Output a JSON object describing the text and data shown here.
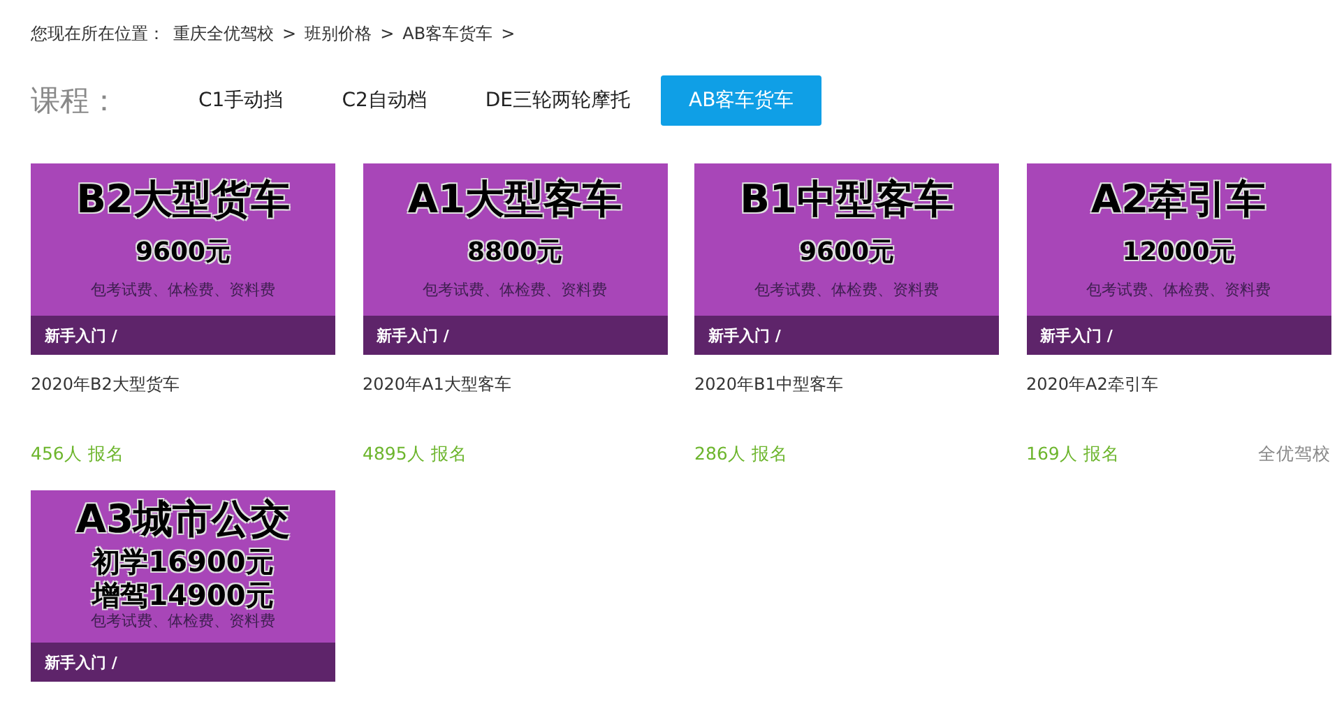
{
  "breadcrumb": {
    "prefix": "您现在所在位置：",
    "items": [
      "重庆全优驾校",
      "班别价格",
      "AB客车货车"
    ],
    "separator": ">"
  },
  "course_filter": {
    "label": "课程：",
    "tabs": [
      {
        "label": "C1手动挡",
        "selected": false
      },
      {
        "label": "C2自动档",
        "selected": false
      },
      {
        "label": "DE三轮两轮摩托",
        "selected": false
      },
      {
        "label": "AB客车货车",
        "selected": true
      }
    ]
  },
  "courses": [
    {
      "banner": {
        "title": "B2大型货车",
        "prices": [
          "9600元"
        ],
        "note": "包考试费、体检费、资料费",
        "tag": "新手入门 /"
      },
      "caption": "2020年B2大型货车",
      "count": "456人",
      "action": "报名"
    },
    {
      "banner": {
        "title": "A1大型客车",
        "prices": [
          "8800元"
        ],
        "note": "包考试费、体检费、资料费",
        "tag": "新手入门 /"
      },
      "caption": "2020年A1大型客车",
      "count": "4895人",
      "action": "报名"
    },
    {
      "banner": {
        "title": "B1中型客车",
        "prices": [
          "9600元"
        ],
        "note": "包考试费、体检费、资料费",
        "tag": "新手入门 /"
      },
      "caption": "2020年B1中型客车",
      "count": "286人",
      "action": "报名"
    },
    {
      "banner": {
        "title": "A2牵引车",
        "prices": [
          "12000元"
        ],
        "note": "包考试费、体检费、资料费",
        "tag": "新手入门 /"
      },
      "caption": "2020年A2牵引车",
      "count": "169人",
      "action": "报名",
      "source": "全优驾校"
    },
    {
      "banner": {
        "title": "A3城市公交",
        "prices": [
          "初学16900元",
          "增驾14900元"
        ],
        "note": "包考试费、体检费、资料费",
        "tag": "新手入门 /"
      }
    }
  ]
}
